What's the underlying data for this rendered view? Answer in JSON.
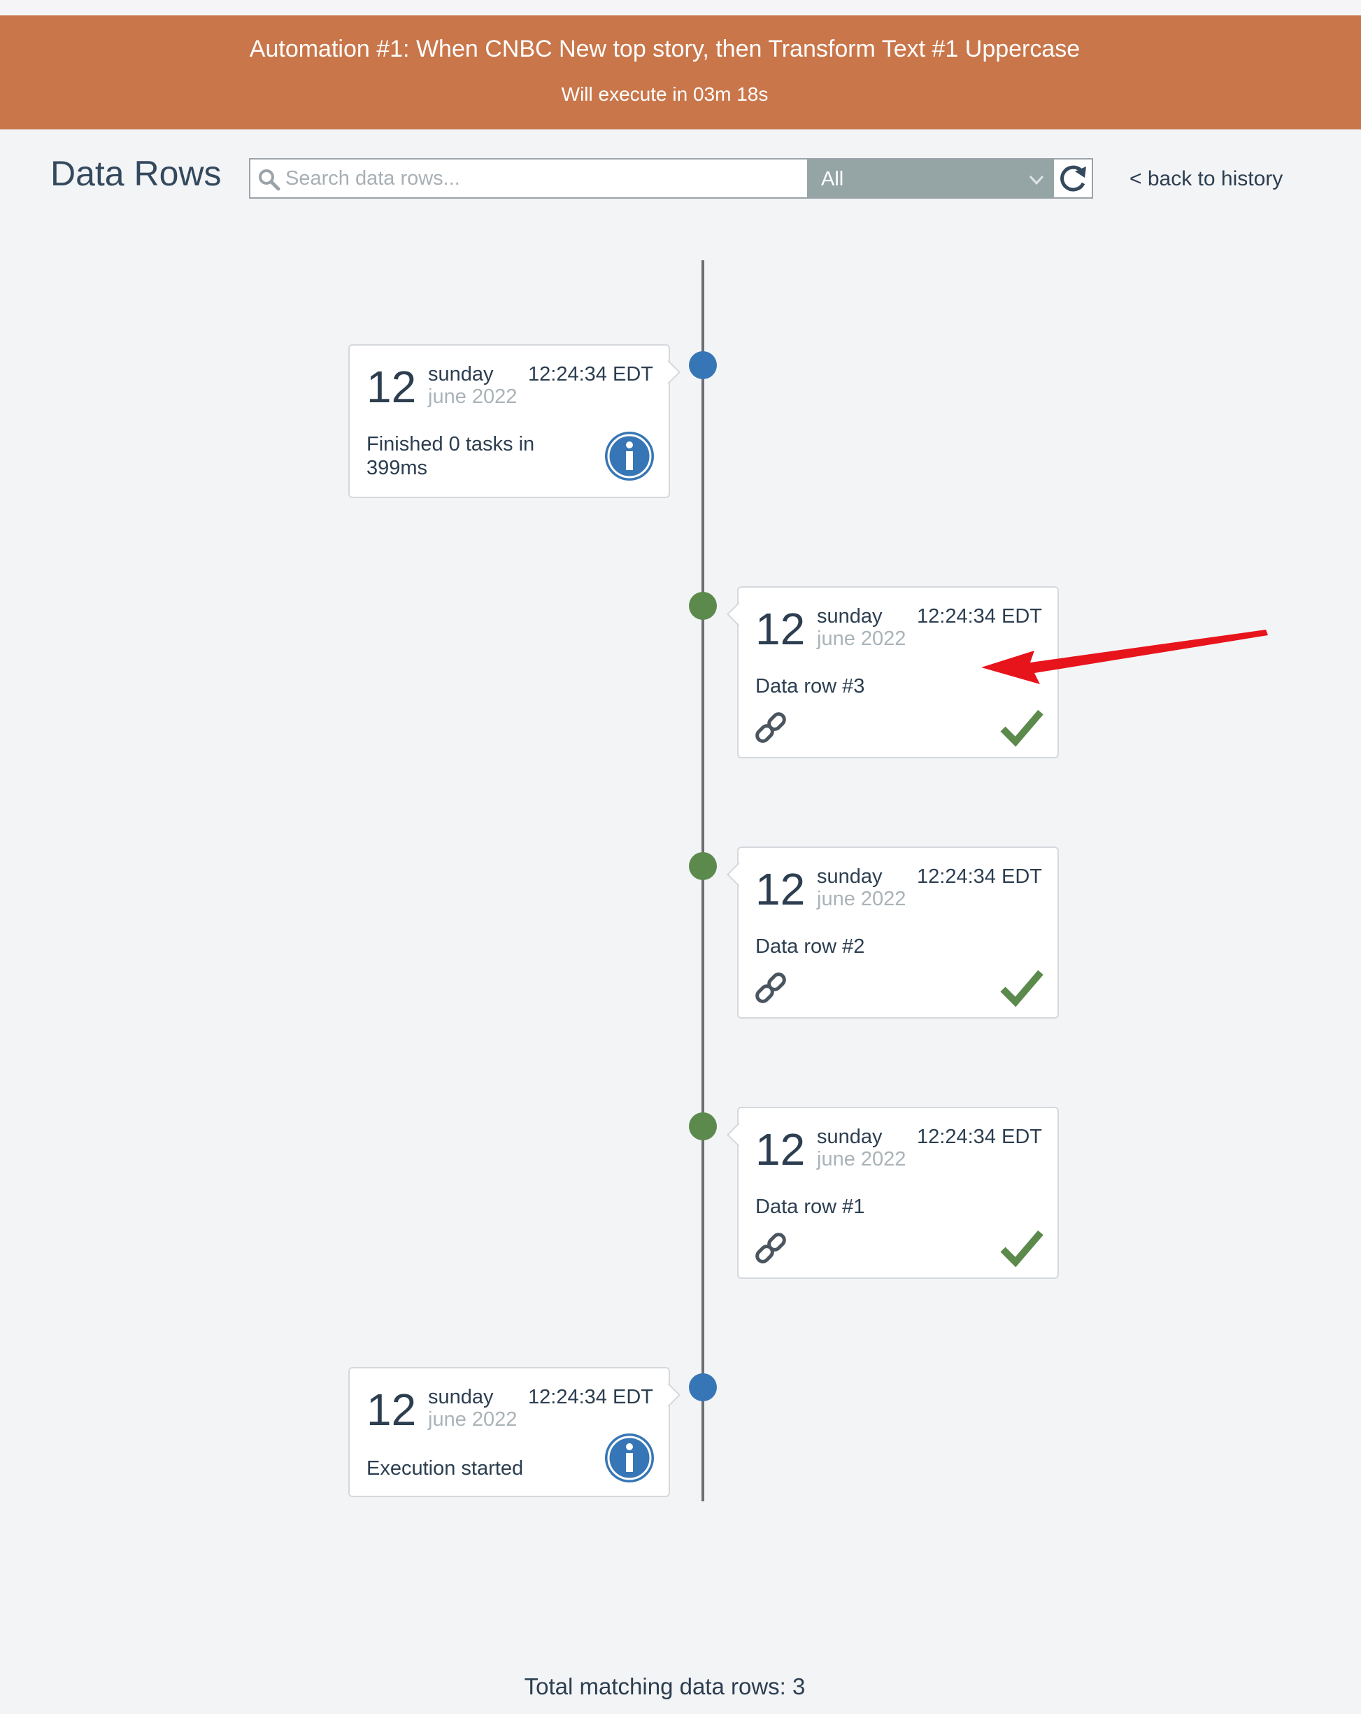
{
  "banner": {
    "title": "Automation #1: When CNBC New top story, then Transform Text #1 Uppercase",
    "subtitle": "Will execute in 03m 18s",
    "color": "#c8764a"
  },
  "header": {
    "title": "Data Rows",
    "search_placeholder": "Search data rows...",
    "search_value": "",
    "filter_selected": "All",
    "back_label": "< back to history"
  },
  "timeline": [
    {
      "side": "left",
      "status": "info",
      "dot_color": "#3676b6",
      "day": "12",
      "weekday": "sunday",
      "month_year": "june 2022",
      "time": "12:24:34 EDT",
      "text": "Finished 0 tasks in 399ms",
      "icon": "info-icon"
    },
    {
      "side": "right",
      "status": "success",
      "dot_color": "#5b8a4c",
      "day": "12",
      "weekday": "sunday",
      "month_year": "june 2022",
      "time": "12:24:34 EDT",
      "text": "Data row #3",
      "icons": [
        "link-icon",
        "checkmark-icon"
      ]
    },
    {
      "side": "right",
      "status": "success",
      "dot_color": "#5b8a4c",
      "day": "12",
      "weekday": "sunday",
      "month_year": "june 2022",
      "time": "12:24:34 EDT",
      "text": "Data row #2",
      "icons": [
        "link-icon",
        "checkmark-icon"
      ]
    },
    {
      "side": "right",
      "status": "success",
      "dot_color": "#5b8a4c",
      "day": "12",
      "weekday": "sunday",
      "month_year": "june 2022",
      "time": "12:24:34 EDT",
      "text": "Data row #1",
      "icons": [
        "link-icon",
        "checkmark-icon"
      ]
    },
    {
      "side": "left",
      "status": "info",
      "dot_color": "#3676b6",
      "day": "12",
      "weekday": "sunday",
      "month_year": "june 2022",
      "time": "12:24:34 EDT",
      "text": "Execution started",
      "icon": "info-icon"
    }
  ],
  "annotation": {
    "icon": "red-arrow-icon",
    "color": "#e8141c"
  },
  "footer": {
    "total_label": "Total matching data rows: 3"
  }
}
